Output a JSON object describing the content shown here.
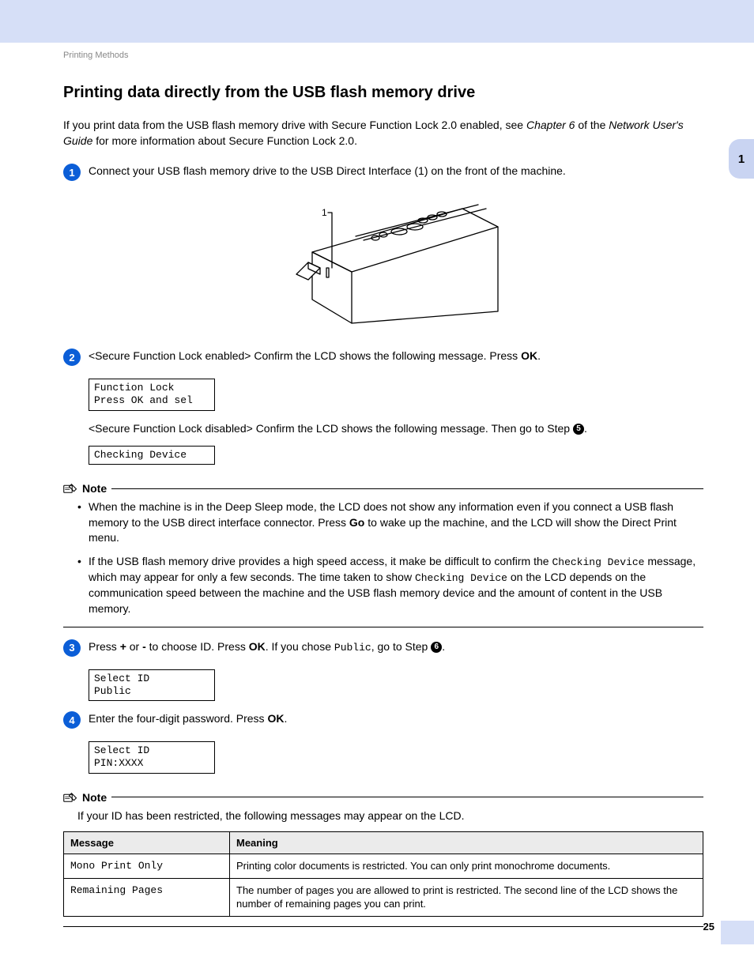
{
  "breadcrumb": "Printing Methods",
  "title": "Printing data directly from the USB flash memory drive",
  "intro_prefix": "If you print data from the USB flash memory drive with Secure Function Lock 2.0 enabled, see ",
  "intro_chapter": "Chapter 6",
  "intro_mid": " of the ",
  "intro_guide": "Network User's Guide",
  "intro_suffix": " for more information about Secure Function Lock 2.0.",
  "step1": "Connect your USB flash memory drive to the USB Direct Interface (1) on the front of the machine.",
  "diagram_callout": "1",
  "step2_prefix": "<Secure Function Lock enabled> Confirm the LCD shows the following message. Press ",
  "step2_ok": "OK",
  "step2_suffix": ".",
  "lcd1_line1": "Function Lock",
  "lcd1_line2": "Press OK and sel",
  "step2b_prefix": "<Secure Function Lock disabled> Confirm the LCD shows the following message. Then go to Step ",
  "step2b_ref": "5",
  "step2b_suffix": ".",
  "lcd2_line1": "Checking Device",
  "note1_title": "Note",
  "note1_item1_a": "When the machine is in the Deep Sleep mode, the LCD does not show any information even if you connect a USB flash memory to the USB direct interface connector. Press ",
  "note1_item1_go": "Go",
  "note1_item1_b": " to wake up the machine, and the LCD will show the Direct Print menu.",
  "note1_item2_a": " If the USB flash memory drive provides a high speed access, it make be difficult to confirm the ",
  "note1_item2_mono1": "Checking Device",
  "note1_item2_b": " message, which may appear for only a few seconds. The time taken to show ",
  "note1_item2_mono2": "Checking Device",
  "note1_item2_c": " on the LCD depends on the communication speed between the machine and the USB flash memory device and the amount of content in the USB memory.",
  "step3_a": "Press ",
  "step3_plus": "+",
  "step3_b": " or ",
  "step3_minus": "-",
  "step3_c": " to choose ID. Press ",
  "step3_ok": "OK",
  "step3_d": ". If you chose ",
  "step3_public": "Public",
  "step3_e": ", go to Step ",
  "step3_ref": "6",
  "step3_f": ".",
  "lcd3_line1": "Select ID",
  "lcd3_line2": "Public",
  "step4_a": "Enter the four-digit password. Press ",
  "step4_ok": "OK",
  "step4_b": ".",
  "lcd4_line1": "Select ID",
  "lcd4_line2": "PIN:XXXX",
  "note2_title": "Note",
  "note2_text": "If your ID has been restricted, the following messages may appear on the LCD.",
  "table_h1": "Message",
  "table_h2": "Meaning",
  "table_r1c1": "Mono Print Only",
  "table_r1c2": "Printing color documents is restricted. You can only print monochrome documents.",
  "table_r2c1": "Remaining Pages",
  "table_r2c2": "The number of pages you are allowed to print is restricted. The second line of the LCD shows the number of remaining pages you can print.",
  "side_tab": "1",
  "page_number": "25"
}
